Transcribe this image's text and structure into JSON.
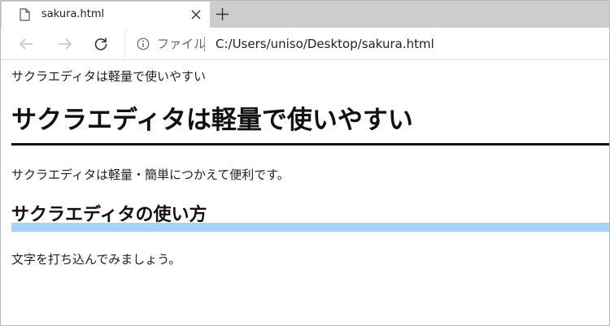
{
  "browser": {
    "tab": {
      "title": "sakura.html",
      "favicon_icon": "document-icon",
      "close_icon": "close-icon"
    },
    "new_tab_icon": "plus-icon",
    "toolbar": {
      "back_icon": "arrow-left-icon",
      "forward_icon": "arrow-right-icon",
      "reload_icon": "reload-icon"
    },
    "omnibox": {
      "info_icon": "info-icon",
      "scheme_label": "ファイル",
      "url": "C:/Users/uniso/Desktop/sakura.html"
    }
  },
  "page": {
    "paragraph_top": "サクラエディタは軽量で使いやすい",
    "heading1": "サクラエディタは軽量で使いやすい",
    "paragraph_intro": "サクラエディタは軽量・簡単につかえて便利です。",
    "heading2": "サクラエディタの使い方",
    "paragraph_body": "文字を打ち込んでみましょう。"
  },
  "colors": {
    "tabstrip_bg": "#cdcdcd",
    "h1_rule": "#111111",
    "h2_underline": "#a9d3f5"
  }
}
